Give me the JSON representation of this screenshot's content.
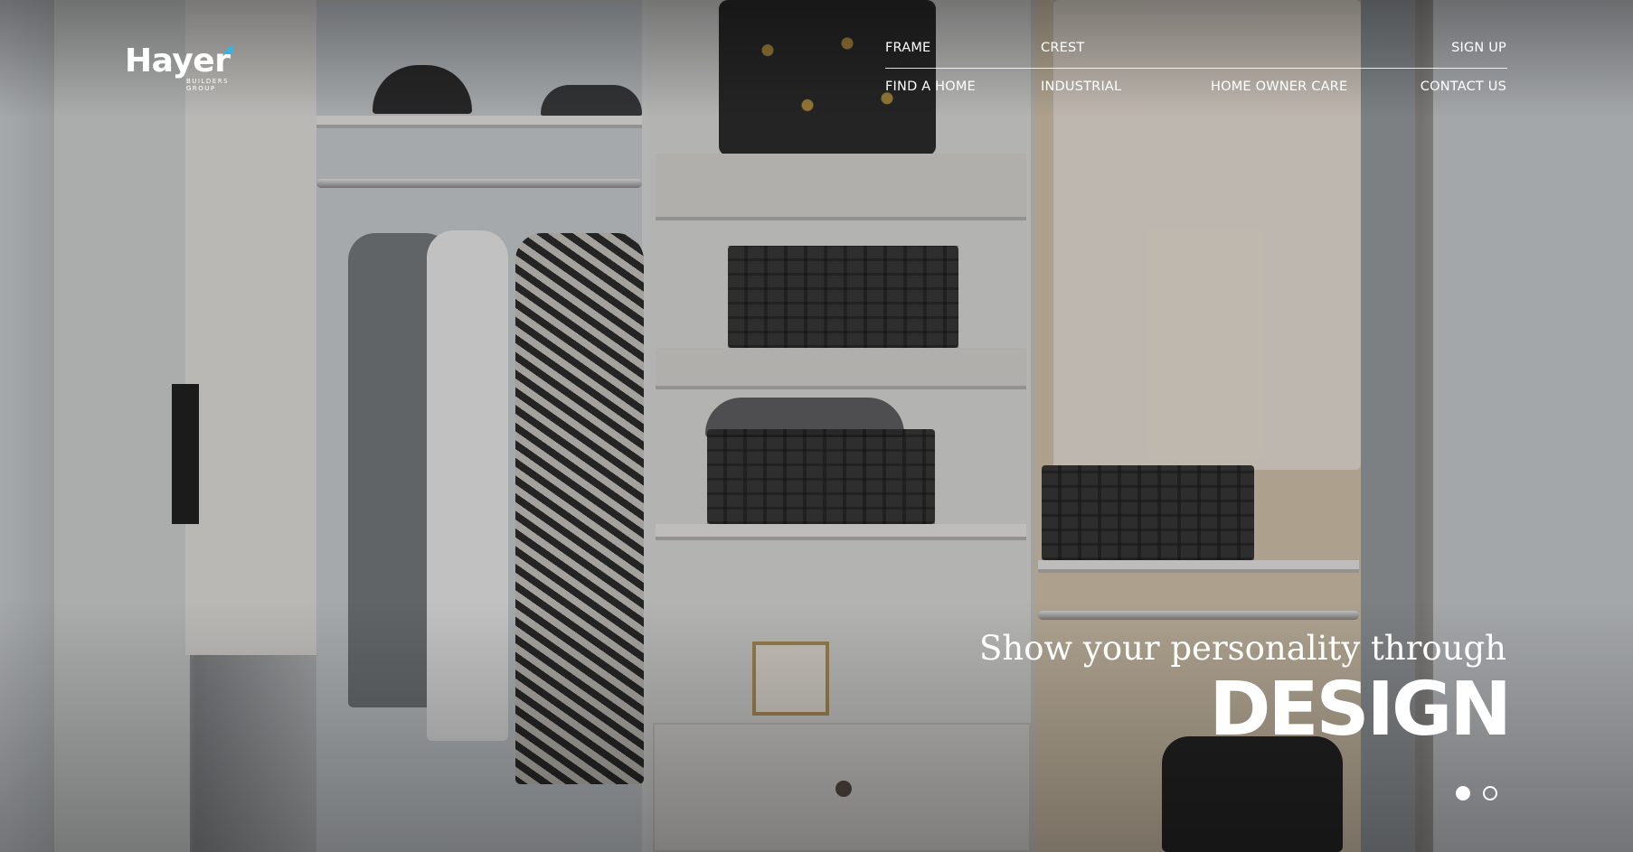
{
  "brand": {
    "name": "Hayer",
    "sub_line1": "BUILDERS",
    "sub_line2": "GROUP",
    "accent_color": "#39b3e0"
  },
  "nav": {
    "top_row": [
      {
        "label": "FRAME"
      },
      {
        "label": "CREST"
      },
      {
        "label": "SIGN UP"
      }
    ],
    "bottom_row": [
      {
        "label": "FIND A HOME"
      },
      {
        "label": "INDUSTRIAL"
      },
      {
        "label": "HOME OWNER CARE"
      },
      {
        "label": "CONTACT US"
      }
    ]
  },
  "hero": {
    "tagline": "Show your personality through",
    "headline": "DESIGN",
    "slides": [
      {
        "active": true
      },
      {
        "active": false
      }
    ]
  }
}
